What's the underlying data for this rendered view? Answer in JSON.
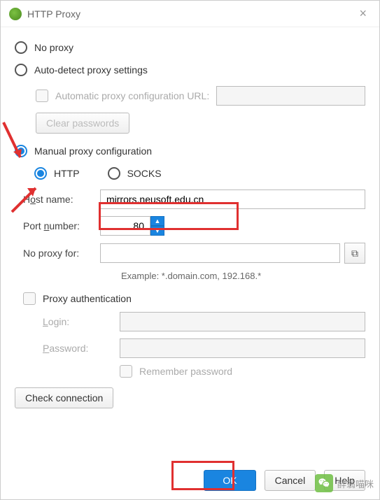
{
  "window": {
    "title": "HTTP Proxy"
  },
  "options": {
    "no_proxy": "No proxy",
    "auto_detect": "Auto-detect proxy settings",
    "auto_config_label": "Automatic proxy configuration URL:",
    "clear_passwords": "Clear passwords",
    "manual": "Manual proxy configuration"
  },
  "protocol": {
    "http": "HTTP",
    "socks": "SOCKS"
  },
  "fields": {
    "host_label_pre": "H",
    "host_label_u": "o",
    "host_label_post": "st name:",
    "host_value": "mirrors.neusoft.edu.cn",
    "port_label_pre": "Port ",
    "port_label_u": "n",
    "port_label_post": "umber:",
    "port_value": "80",
    "noproxy_label": "No proxy for:",
    "example": "Example: *.domain.com, 192.168.*"
  },
  "auth": {
    "title": "Proxy authentication",
    "login_u": "L",
    "login_post": "ogin:",
    "pass_u": "P",
    "pass_post": "assword:",
    "remember_u": "R",
    "remember_post": "emember password"
  },
  "actions": {
    "check": "Check connection",
    "ok": "OK",
    "cancel": "Cancel",
    "help": "Help"
  },
  "watermark": "醉翁喵咪"
}
